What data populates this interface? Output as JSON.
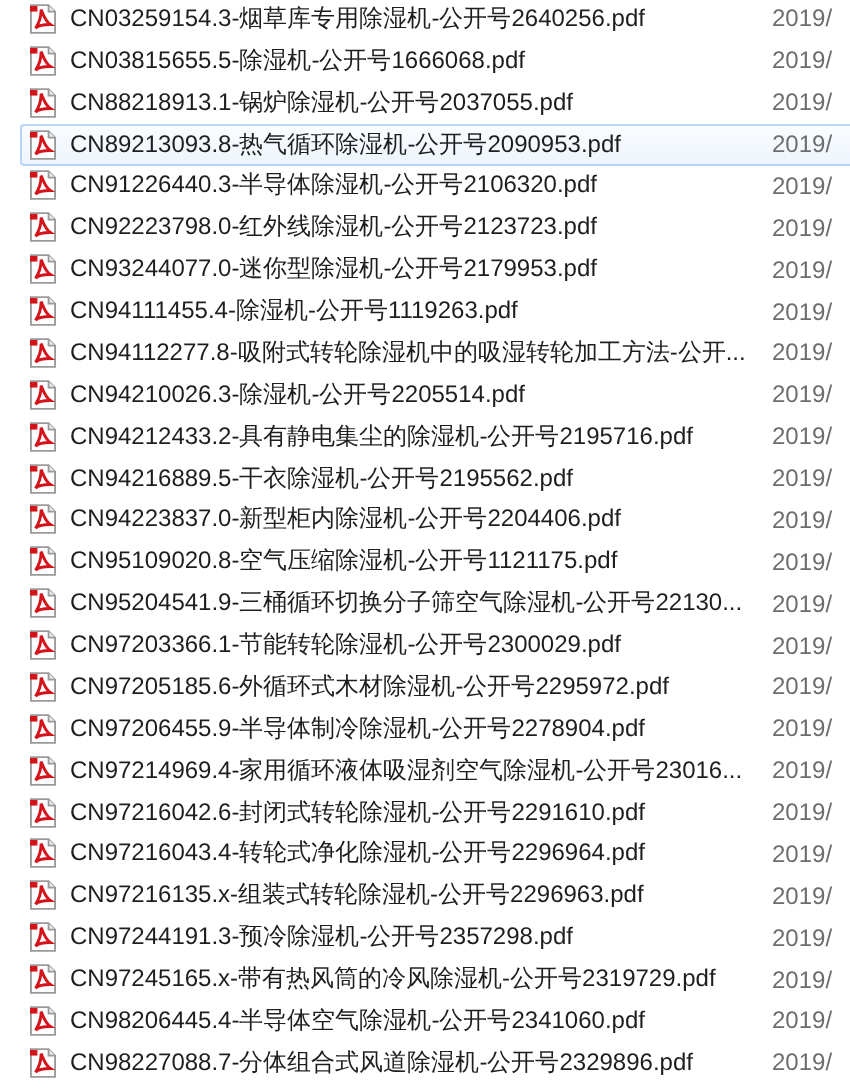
{
  "files": [
    {
      "name": "CN03259154.3-烟草库专用除湿机-公开号2640256.pdf",
      "date": "2019/",
      "hovered": false
    },
    {
      "name": "CN03815655.5-除湿机-公开号1666068.pdf",
      "date": "2019/",
      "hovered": false
    },
    {
      "name": "CN88218913.1-锅炉除湿机-公开号2037055.pdf",
      "date": "2019/",
      "hovered": false
    },
    {
      "name": "CN89213093.8-热气循环除湿机-公开号2090953.pdf",
      "date": "2019/",
      "hovered": true
    },
    {
      "name": "CN91226440.3-半导体除湿机-公开号2106320.pdf",
      "date": "2019/",
      "hovered": false
    },
    {
      "name": "CN92223798.0-红外线除湿机-公开号2123723.pdf",
      "date": "2019/",
      "hovered": false
    },
    {
      "name": "CN93244077.0-迷你型除湿机-公开号2179953.pdf",
      "date": "2019/",
      "hovered": false
    },
    {
      "name": "CN94111455.4-除湿机-公开号1119263.pdf",
      "date": "2019/",
      "hovered": false
    },
    {
      "name": "CN94112277.8-吸附式转轮除湿机中的吸湿转轮加工方法-公开...",
      "date": "2019/",
      "hovered": false
    },
    {
      "name": "CN94210026.3-除湿机-公开号2205514.pdf",
      "date": "2019/",
      "hovered": false
    },
    {
      "name": "CN94212433.2-具有静电集尘的除湿机-公开号2195716.pdf",
      "date": "2019/",
      "hovered": false
    },
    {
      "name": "CN94216889.5-干衣除湿机-公开号2195562.pdf",
      "date": "2019/",
      "hovered": false
    },
    {
      "name": "CN94223837.0-新型柜内除湿机-公开号2204406.pdf",
      "date": "2019/",
      "hovered": false
    },
    {
      "name": "CN95109020.8-空气压缩除湿机-公开号1121175.pdf",
      "date": "2019/",
      "hovered": false
    },
    {
      "name": "CN95204541.9-三桶循环切换分子筛空气除湿机-公开号22130...",
      "date": "2019/",
      "hovered": false
    },
    {
      "name": "CN97203366.1-节能转轮除湿机-公开号2300029.pdf",
      "date": "2019/",
      "hovered": false
    },
    {
      "name": "CN97205185.6-外循环式木材除湿机-公开号2295972.pdf",
      "date": "2019/",
      "hovered": false
    },
    {
      "name": "CN97206455.9-半导体制冷除湿机-公开号2278904.pdf",
      "date": "2019/",
      "hovered": false
    },
    {
      "name": "CN97214969.4-家用循环液体吸湿剂空气除湿机-公开号23016...",
      "date": "2019/",
      "hovered": false
    },
    {
      "name": "CN97216042.6-封闭式转轮除湿机-公开号2291610.pdf",
      "date": "2019/",
      "hovered": false
    },
    {
      "name": "CN97216043.4-转轮式净化除湿机-公开号2296964.pdf",
      "date": "2019/",
      "hovered": false
    },
    {
      "name": "CN97216135.x-组装式转轮除湿机-公开号2296963.pdf",
      "date": "2019/",
      "hovered": false
    },
    {
      "name": "CN97244191.3-预冷除湿机-公开号2357298.pdf",
      "date": "2019/",
      "hovered": false
    },
    {
      "name": "CN97245165.x-带有热风筒的冷风除湿机-公开号2319729.pdf",
      "date": "2019/",
      "hovered": false
    },
    {
      "name": "CN98206445.4-半导体空气除湿机-公开号2341060.pdf",
      "date": "2019/",
      "hovered": false
    },
    {
      "name": "CN98227088.7-分体组合式风道除湿机-公开号2329896.pdf",
      "date": "2019/",
      "hovered": false
    }
  ]
}
